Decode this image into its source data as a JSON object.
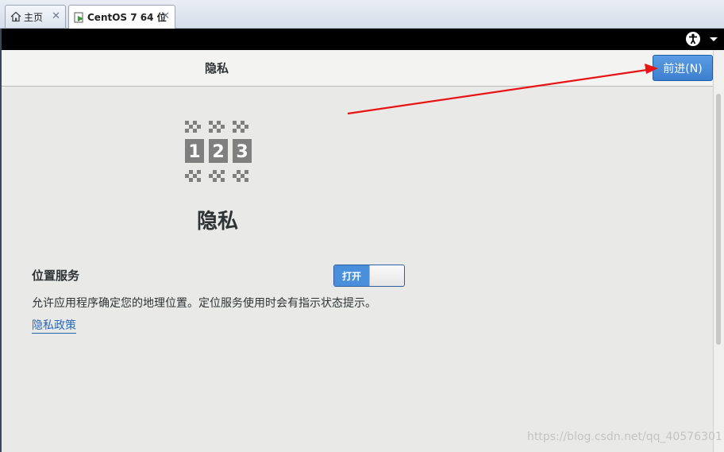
{
  "tabs": [
    {
      "label": "主页",
      "icon": "home-icon"
    },
    {
      "label": "CentOS 7 64 位",
      "icon": "vm-icon"
    }
  ],
  "header": {
    "title": "隐私",
    "next_label": "前进(N)"
  },
  "main": {
    "logo_icon": "privacy-123-icon",
    "logo_digits": [
      "1",
      "2",
      "3"
    ],
    "title": "隐私",
    "location_label": "位置服务",
    "toggle_state": "打开",
    "description": "允许应用程序确定您的地理位置。定位服务使用时会有指示状态提示。",
    "policy_link": "隐私政策"
  },
  "watermark": "https://blog.csdn.net/qq_40576301",
  "colors": {
    "accent": "#4a8fdb",
    "annotation_arrow": "#e81414"
  }
}
